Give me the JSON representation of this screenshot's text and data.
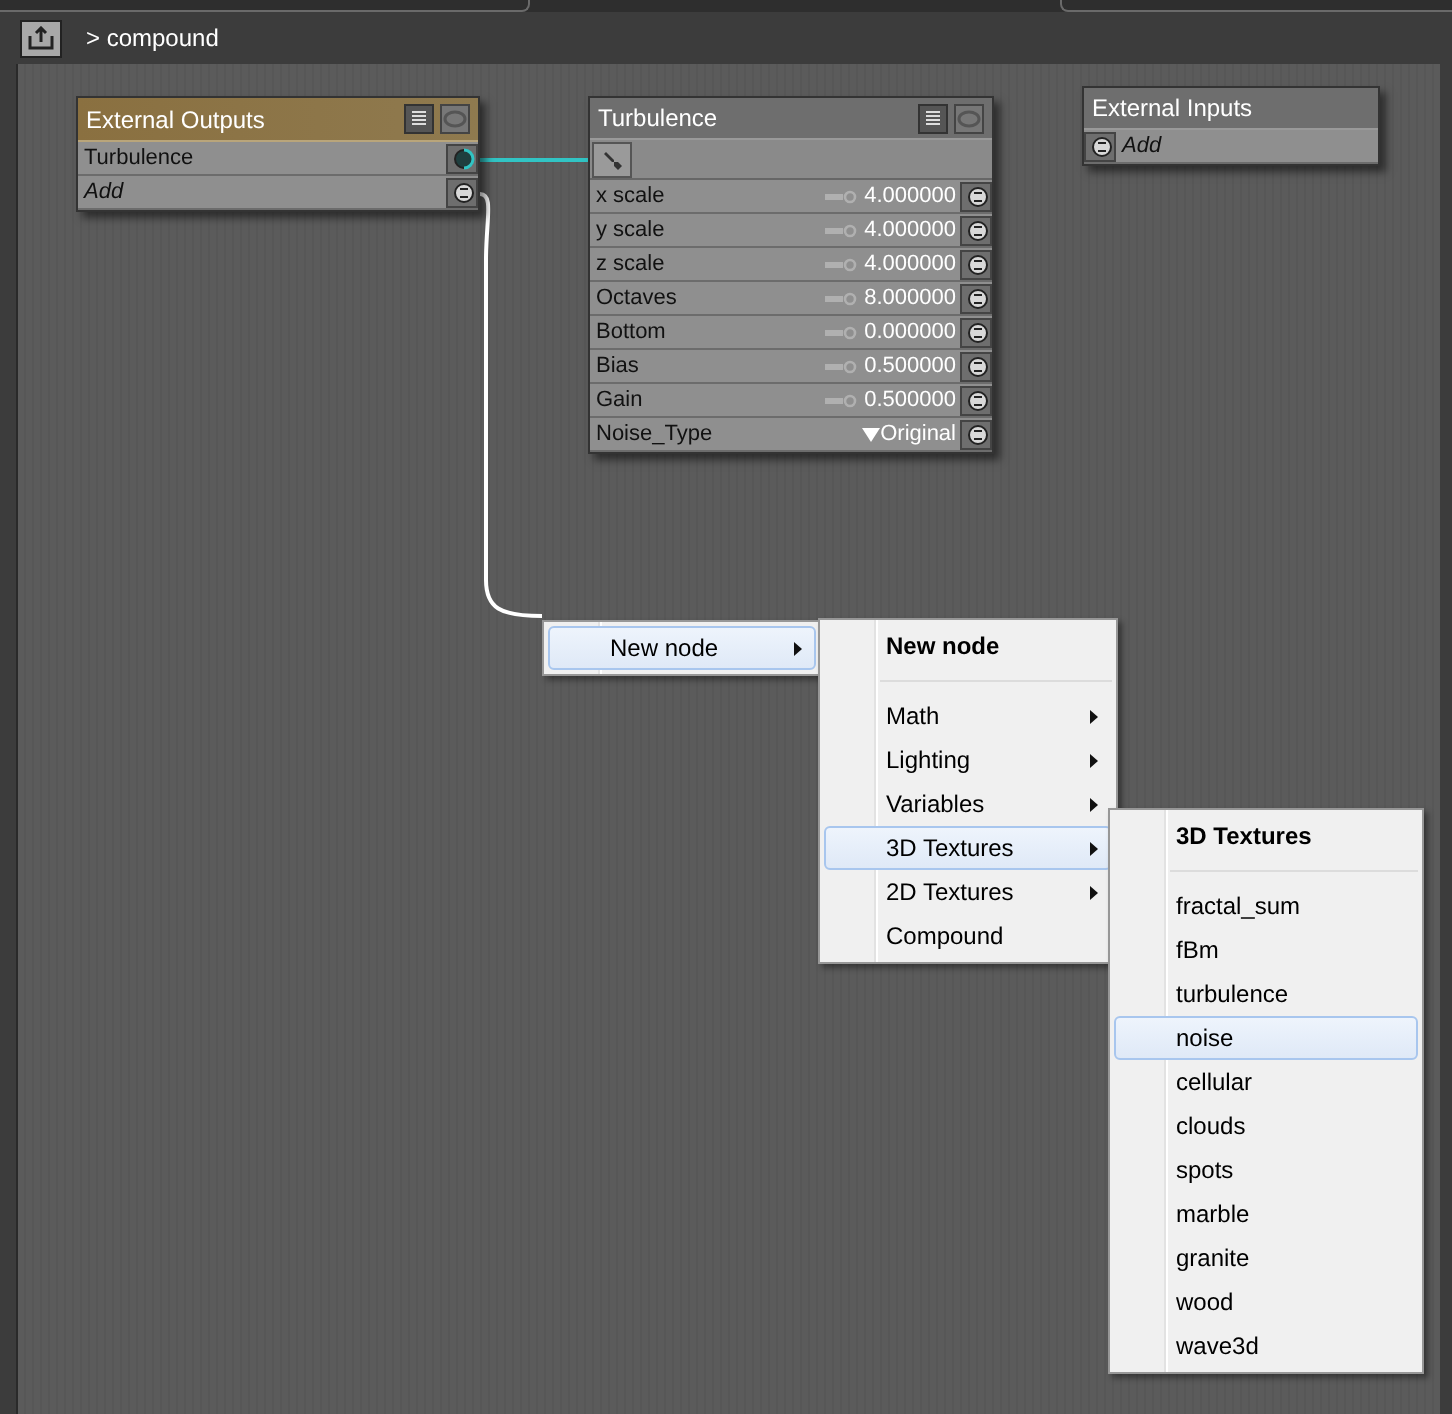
{
  "path": "> compound",
  "nodes": [
    {
      "kind": "outputs",
      "title": "External Outputs",
      "rows": [
        {
          "label": "Turbulence",
          "italic": false,
          "connected": true
        },
        {
          "label": "Add",
          "italic": true,
          "connected": false
        }
      ]
    },
    {
      "kind": "params",
      "title": "Turbulence",
      "rows": [
        {
          "label": "x scale",
          "value": "4.000000",
          "kind": "number"
        },
        {
          "label": "y scale",
          "value": "4.000000",
          "kind": "number"
        },
        {
          "label": "z scale",
          "value": "4.000000",
          "kind": "number"
        },
        {
          "label": "Octaves",
          "value": "8.000000",
          "kind": "number"
        },
        {
          "label": "Bottom",
          "value": "0.000000",
          "kind": "number"
        },
        {
          "label": "Bias",
          "value": "0.500000",
          "kind": "number"
        },
        {
          "label": "Gain",
          "value": "0.500000",
          "kind": "number"
        },
        {
          "label": "Noise_Type",
          "value": "Original",
          "kind": "choice"
        }
      ]
    },
    {
      "kind": "inputs",
      "title": "External Inputs",
      "rows": [
        {
          "label": "Add",
          "italic": true,
          "connected": false
        }
      ]
    }
  ],
  "menus": [
    {
      "items": [
        {
          "label": "New node",
          "selected": true,
          "submenu": true
        }
      ]
    },
    {
      "header": "New node",
      "items": [
        {
          "label": "Math",
          "selected": false,
          "submenu": true
        },
        {
          "label": "Lighting",
          "selected": false,
          "submenu": true
        },
        {
          "label": "Variables",
          "selected": false,
          "submenu": true
        },
        {
          "label": "3D Textures",
          "selected": true,
          "submenu": true
        },
        {
          "label": "2D Textures",
          "selected": false,
          "submenu": true
        },
        {
          "label": "Compound",
          "selected": false,
          "submenu": false
        }
      ]
    },
    {
      "header": "3D Textures",
      "items": [
        {
          "label": "fractal_sum",
          "selected": false,
          "submenu": false
        },
        {
          "label": "fBm",
          "selected": false,
          "submenu": false
        },
        {
          "label": "turbulence",
          "selected": false,
          "submenu": false
        },
        {
          "label": "noise",
          "selected": true,
          "submenu": false
        },
        {
          "label": "cellular",
          "selected": false,
          "submenu": false
        },
        {
          "label": "clouds",
          "selected": false,
          "submenu": false
        },
        {
          "label": "spots",
          "selected": false,
          "submenu": false
        },
        {
          "label": "marble",
          "selected": false,
          "submenu": false
        },
        {
          "label": "granite",
          "selected": false,
          "submenu": false
        },
        {
          "label": "wood",
          "selected": false,
          "submenu": false
        },
        {
          "label": "wave3d",
          "selected": false,
          "submenu": false
        }
      ]
    }
  ]
}
